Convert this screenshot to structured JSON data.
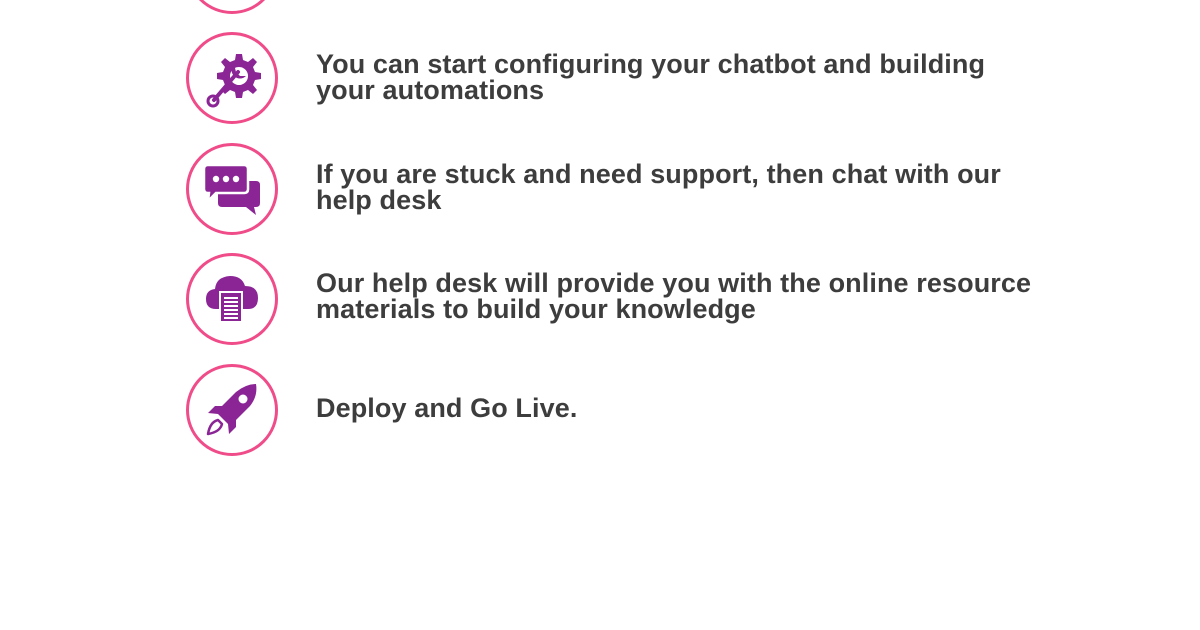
{
  "colors": {
    "accent_ring": "#ef4c89",
    "icon_fill": "#8b2596",
    "text": "#3d3d3d",
    "background": "#ffffff"
  },
  "steps": [
    {
      "icon": "gear-wrench-icon",
      "text": "You can start configuring your chatbot and building your automations"
    },
    {
      "icon": "chat-bubbles-icon",
      "text": "If you are stuck and need support, then chat with our help desk"
    },
    {
      "icon": "cloud-document-icon",
      "text": "Our help desk will provide you with the online resource materials to build your knowledge"
    },
    {
      "icon": "rocket-icon",
      "text": "Deploy and Go Live."
    }
  ]
}
